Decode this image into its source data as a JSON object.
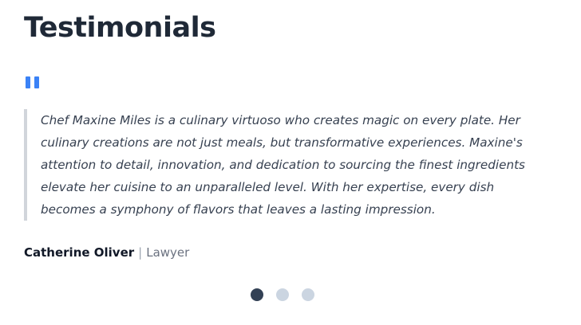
{
  "section": {
    "title": "Testimonials"
  },
  "testimonial": {
    "quote_icon": "quote-icon",
    "quote": "Chef Maxine Miles is a culinary virtuoso who creates magic on every plate. Her culinary creations are not just meals, but transformative experiences. Maxine's attention to detail, innovation, and dedication to sourcing the finest ingredients elevate her cuisine to an unparalleled level. With her expertise, every dish becomes a symphony of flavors that leaves a lasting impression.",
    "author_name": "Catherine Oliver",
    "separator": "|",
    "author_role": "Lawyer"
  },
  "pagination": {
    "active_index": 0,
    "count": 3
  },
  "colors": {
    "accent": "#3b82f6",
    "dot_active": "#334155",
    "dot_inactive": "#cbd5e1",
    "border": "#d1d5db"
  }
}
